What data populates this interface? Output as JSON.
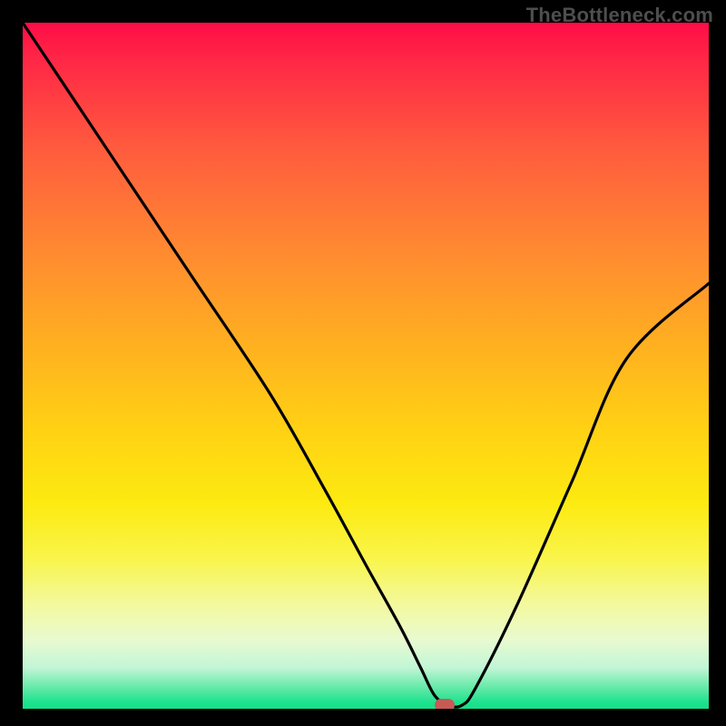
{
  "watermark": "TheBottleneck.com",
  "chart_data": {
    "type": "line",
    "title": "",
    "xlabel": "",
    "ylabel": "",
    "xlim": [
      0,
      100
    ],
    "ylim": [
      0,
      100
    ],
    "x": [
      0,
      12,
      24,
      36,
      44,
      50,
      55,
      58,
      60,
      62,
      64,
      66,
      72,
      80,
      88,
      100
    ],
    "values": [
      100,
      82,
      64,
      46,
      32,
      21,
      12,
      6,
      2,
      0.5,
      0.5,
      3,
      15,
      33,
      51,
      62
    ],
    "annotations": [
      {
        "label": "min-marker",
        "x": 61.5,
        "y": 0.5
      }
    ],
    "background_gradient": {
      "direction": "vertical",
      "stops": [
        {
          "pos": 0,
          "color": "#ff0d47"
        },
        {
          "pos": 50,
          "color": "#ffb31f"
        },
        {
          "pos": 70,
          "color": "#fcea10"
        },
        {
          "pos": 90,
          "color": "#e8fad0"
        },
        {
          "pos": 100,
          "color": "#15df89"
        }
      ]
    }
  },
  "colors": {
    "frame": "#000000",
    "curve": "#000000",
    "marker": "#c85a56",
    "watermark": "#4e4e4e"
  }
}
